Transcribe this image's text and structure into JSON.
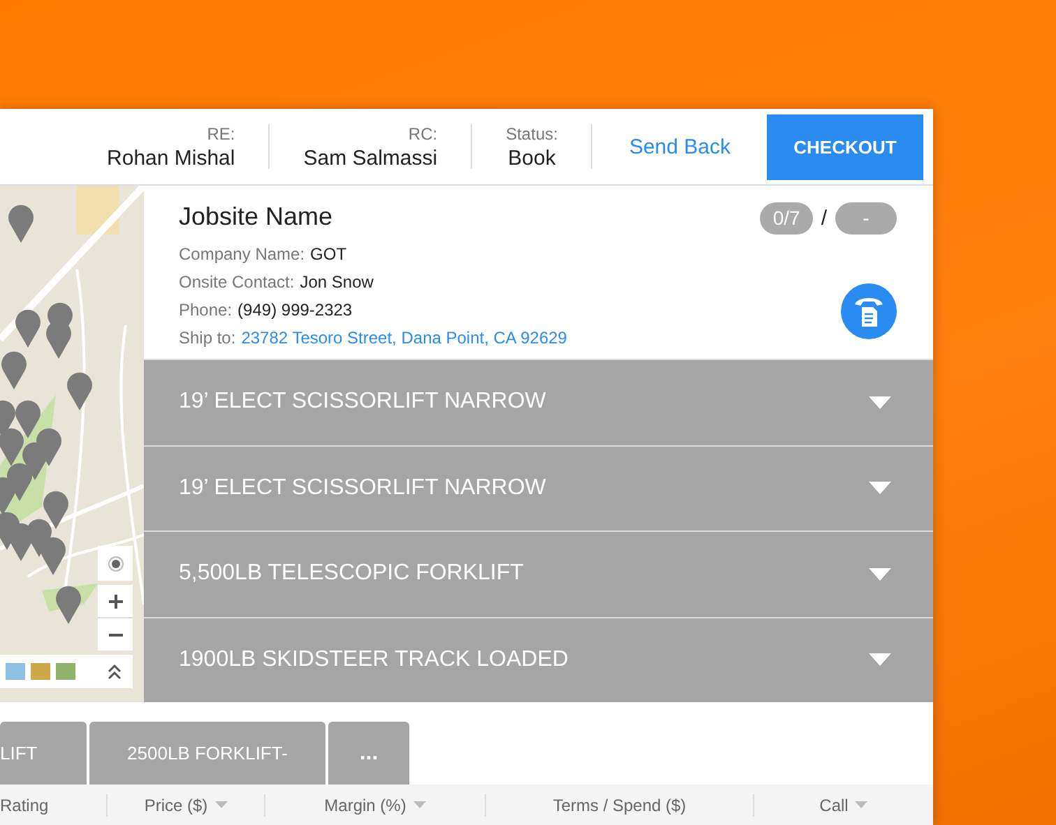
{
  "header": {
    "fields": [
      {
        "label": "RE:",
        "value": "Rohan Mishal"
      },
      {
        "label": "RC:",
        "value": "Sam Salmassi"
      },
      {
        "label": "Status:",
        "value": "Book"
      }
    ],
    "link": "Send Back",
    "button": "CHECKOUT"
  },
  "jobsite": {
    "title": "Jobsite Name",
    "lines": [
      {
        "label": "Company Name:",
        "value": "GOT",
        "kind": "text"
      },
      {
        "label": "Onsite Contact:",
        "value": "Jon Snow",
        "kind": "text"
      },
      {
        "label": "Phone:",
        "value": "(949) 999-2323",
        "kind": "text"
      },
      {
        "label": "Ship to:",
        "value": "23782 Tesoro Street, Dana Point, CA 92629",
        "kind": "link"
      }
    ],
    "count": "0/7",
    "separator": "/",
    "count2": "-"
  },
  "items": [
    {
      "label": "19’ ELECT SCISSORLIFT NARROW",
      "expanded": false
    },
    {
      "label": "19’ ELECT SCISSORLIFT NARROW",
      "expanded": false
    },
    {
      "label": "5,500LB TELESCOPIC FORKLIFT",
      "expanded": false
    },
    {
      "label": "1900LB SKIDSTEER TRACK LOADED",
      "expanded": false
    }
  ],
  "tabs": [
    {
      "label": "LIFT"
    },
    {
      "label": "2500LB FORKLIFT-"
    },
    {
      "label": "..."
    }
  ],
  "table": {
    "columns": [
      {
        "label": "Rating",
        "sortable": false
      },
      {
        "label": "Price ($)",
        "sortable": true
      },
      {
        "label": "Margin (%)",
        "sortable": true
      },
      {
        "label": "Terms / Spend ($)",
        "sortable": false
      },
      {
        "label": "Call",
        "sortable": true
      }
    ]
  }
}
